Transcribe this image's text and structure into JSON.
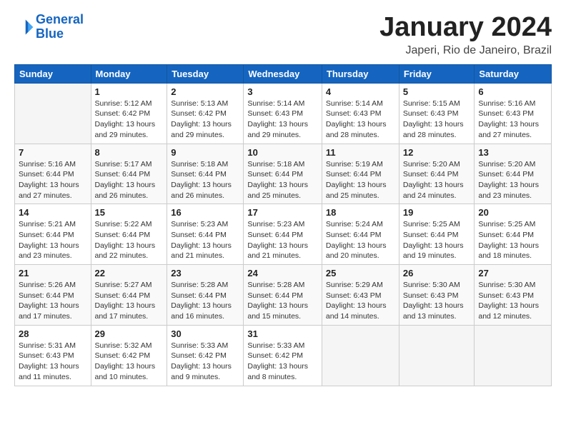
{
  "logo": {
    "line1": "General",
    "line2": "Blue"
  },
  "title": "January 2024",
  "subtitle": "Japeri, Rio de Janeiro, Brazil",
  "days_of_week": [
    "Sunday",
    "Monday",
    "Tuesday",
    "Wednesday",
    "Thursday",
    "Friday",
    "Saturday"
  ],
  "weeks": [
    [
      {
        "day": "",
        "info": ""
      },
      {
        "day": "1",
        "info": "Sunrise: 5:12 AM\nSunset: 6:42 PM\nDaylight: 13 hours\nand 29 minutes."
      },
      {
        "day": "2",
        "info": "Sunrise: 5:13 AM\nSunset: 6:42 PM\nDaylight: 13 hours\nand 29 minutes."
      },
      {
        "day": "3",
        "info": "Sunrise: 5:14 AM\nSunset: 6:43 PM\nDaylight: 13 hours\nand 29 minutes."
      },
      {
        "day": "4",
        "info": "Sunrise: 5:14 AM\nSunset: 6:43 PM\nDaylight: 13 hours\nand 28 minutes."
      },
      {
        "day": "5",
        "info": "Sunrise: 5:15 AM\nSunset: 6:43 PM\nDaylight: 13 hours\nand 28 minutes."
      },
      {
        "day": "6",
        "info": "Sunrise: 5:16 AM\nSunset: 6:43 PM\nDaylight: 13 hours\nand 27 minutes."
      }
    ],
    [
      {
        "day": "7",
        "info": "Sunrise: 5:16 AM\nSunset: 6:44 PM\nDaylight: 13 hours\nand 27 minutes."
      },
      {
        "day": "8",
        "info": "Sunrise: 5:17 AM\nSunset: 6:44 PM\nDaylight: 13 hours\nand 26 minutes."
      },
      {
        "day": "9",
        "info": "Sunrise: 5:18 AM\nSunset: 6:44 PM\nDaylight: 13 hours\nand 26 minutes."
      },
      {
        "day": "10",
        "info": "Sunrise: 5:18 AM\nSunset: 6:44 PM\nDaylight: 13 hours\nand 25 minutes."
      },
      {
        "day": "11",
        "info": "Sunrise: 5:19 AM\nSunset: 6:44 PM\nDaylight: 13 hours\nand 25 minutes."
      },
      {
        "day": "12",
        "info": "Sunrise: 5:20 AM\nSunset: 6:44 PM\nDaylight: 13 hours\nand 24 minutes."
      },
      {
        "day": "13",
        "info": "Sunrise: 5:20 AM\nSunset: 6:44 PM\nDaylight: 13 hours\nand 23 minutes."
      }
    ],
    [
      {
        "day": "14",
        "info": "Sunrise: 5:21 AM\nSunset: 6:44 PM\nDaylight: 13 hours\nand 23 minutes."
      },
      {
        "day": "15",
        "info": "Sunrise: 5:22 AM\nSunset: 6:44 PM\nDaylight: 13 hours\nand 22 minutes."
      },
      {
        "day": "16",
        "info": "Sunrise: 5:23 AM\nSunset: 6:44 PM\nDaylight: 13 hours\nand 21 minutes."
      },
      {
        "day": "17",
        "info": "Sunrise: 5:23 AM\nSunset: 6:44 PM\nDaylight: 13 hours\nand 21 minutes."
      },
      {
        "day": "18",
        "info": "Sunrise: 5:24 AM\nSunset: 6:44 PM\nDaylight: 13 hours\nand 20 minutes."
      },
      {
        "day": "19",
        "info": "Sunrise: 5:25 AM\nSunset: 6:44 PM\nDaylight: 13 hours\nand 19 minutes."
      },
      {
        "day": "20",
        "info": "Sunrise: 5:25 AM\nSunset: 6:44 PM\nDaylight: 13 hours\nand 18 minutes."
      }
    ],
    [
      {
        "day": "21",
        "info": "Sunrise: 5:26 AM\nSunset: 6:44 PM\nDaylight: 13 hours\nand 17 minutes."
      },
      {
        "day": "22",
        "info": "Sunrise: 5:27 AM\nSunset: 6:44 PM\nDaylight: 13 hours\nand 17 minutes."
      },
      {
        "day": "23",
        "info": "Sunrise: 5:28 AM\nSunset: 6:44 PM\nDaylight: 13 hours\nand 16 minutes."
      },
      {
        "day": "24",
        "info": "Sunrise: 5:28 AM\nSunset: 6:44 PM\nDaylight: 13 hours\nand 15 minutes."
      },
      {
        "day": "25",
        "info": "Sunrise: 5:29 AM\nSunset: 6:43 PM\nDaylight: 13 hours\nand 14 minutes."
      },
      {
        "day": "26",
        "info": "Sunrise: 5:30 AM\nSunset: 6:43 PM\nDaylight: 13 hours\nand 13 minutes."
      },
      {
        "day": "27",
        "info": "Sunrise: 5:30 AM\nSunset: 6:43 PM\nDaylight: 13 hours\nand 12 minutes."
      }
    ],
    [
      {
        "day": "28",
        "info": "Sunrise: 5:31 AM\nSunset: 6:43 PM\nDaylight: 13 hours\nand 11 minutes."
      },
      {
        "day": "29",
        "info": "Sunrise: 5:32 AM\nSunset: 6:42 PM\nDaylight: 13 hours\nand 10 minutes."
      },
      {
        "day": "30",
        "info": "Sunrise: 5:33 AM\nSunset: 6:42 PM\nDaylight: 13 hours\nand 9 minutes."
      },
      {
        "day": "31",
        "info": "Sunrise: 5:33 AM\nSunset: 6:42 PM\nDaylight: 13 hours\nand 8 minutes."
      },
      {
        "day": "",
        "info": ""
      },
      {
        "day": "",
        "info": ""
      },
      {
        "day": "",
        "info": ""
      }
    ]
  ]
}
